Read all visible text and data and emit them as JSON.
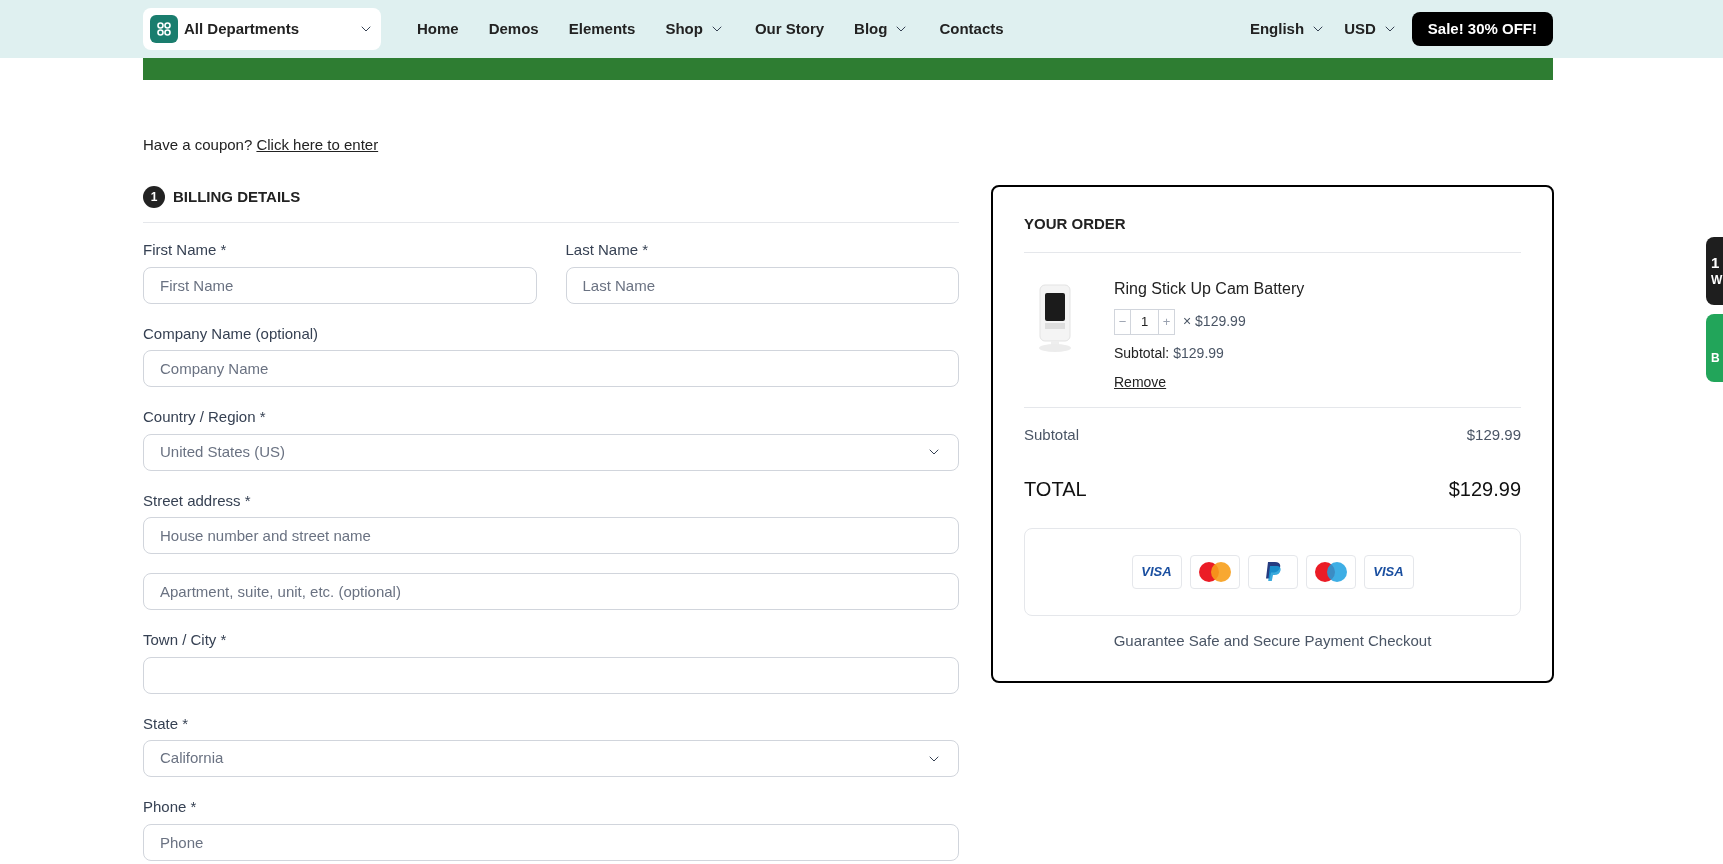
{
  "header": {
    "departments": "All Departments",
    "nav": [
      {
        "label": "Home",
        "dropdown": false
      },
      {
        "label": "Demos",
        "dropdown": false
      },
      {
        "label": "Elements",
        "dropdown": false
      },
      {
        "label": "Shop",
        "dropdown": true
      },
      {
        "label": "Our Story",
        "dropdown": false
      },
      {
        "label": "Blog",
        "dropdown": true
      },
      {
        "label": "Contacts",
        "dropdown": false
      }
    ],
    "language": "English",
    "currency": "USD",
    "sale": "Sale! 30% OFF!"
  },
  "notice": {
    "shown": true
  },
  "coupon": {
    "text": "Have a coupon?",
    "link": "Click here to enter"
  },
  "billing": {
    "step": "1",
    "title": "BILLING DETAILS",
    "fields": [
      {
        "kind": "input",
        "label": "First Name *",
        "placeholder": "First Name",
        "half": true
      },
      {
        "kind": "input",
        "label": "Last Name *",
        "placeholder": "Last Name",
        "half": true
      },
      {
        "kind": "input",
        "label": "Company Name (optional)",
        "placeholder": "Company Name"
      },
      {
        "kind": "select",
        "label": "Country / Region *",
        "value": "United States (US)"
      },
      {
        "kind": "input",
        "label": "Street address *",
        "placeholder": "House number and street name"
      },
      {
        "kind": "input",
        "placeholder": "Apartment, suite, unit, etc. (optional)"
      },
      {
        "kind": "input",
        "label": "Town / City *"
      },
      {
        "kind": "select",
        "label": "State *",
        "value": "California"
      },
      {
        "kind": "input",
        "label": "Phone *",
        "placeholder": "Phone"
      }
    ]
  },
  "order": {
    "title": "YOUR ORDER",
    "item": {
      "name": "Ring Stick Up Cam Battery",
      "minus": "−",
      "quantity": "1",
      "plus": "+",
      "price": "× $129.99",
      "subtotal_label": "Subtotal:",
      "subtotal": "$129.99",
      "remove": "Remove"
    },
    "subtotal_label": "Subtotal",
    "subtotal": "$129.99",
    "total_label": "TOTAL",
    "total": "$129.99",
    "payments": [
      {
        "kind": "visa",
        "label": "VISA"
      },
      {
        "kind": "mastercard"
      },
      {
        "kind": "paypal"
      },
      {
        "kind": "maestro"
      },
      {
        "kind": "visa",
        "label": "VISA"
      }
    ],
    "guarantee": "Guarantee Safe and Secure Payment Checkout"
  },
  "side_tabs": [
    {
      "kind": "dark",
      "lines": [
        "1",
        "W"
      ]
    },
    {
      "kind": "green",
      "lines": [
        "B"
      ]
    }
  ]
}
